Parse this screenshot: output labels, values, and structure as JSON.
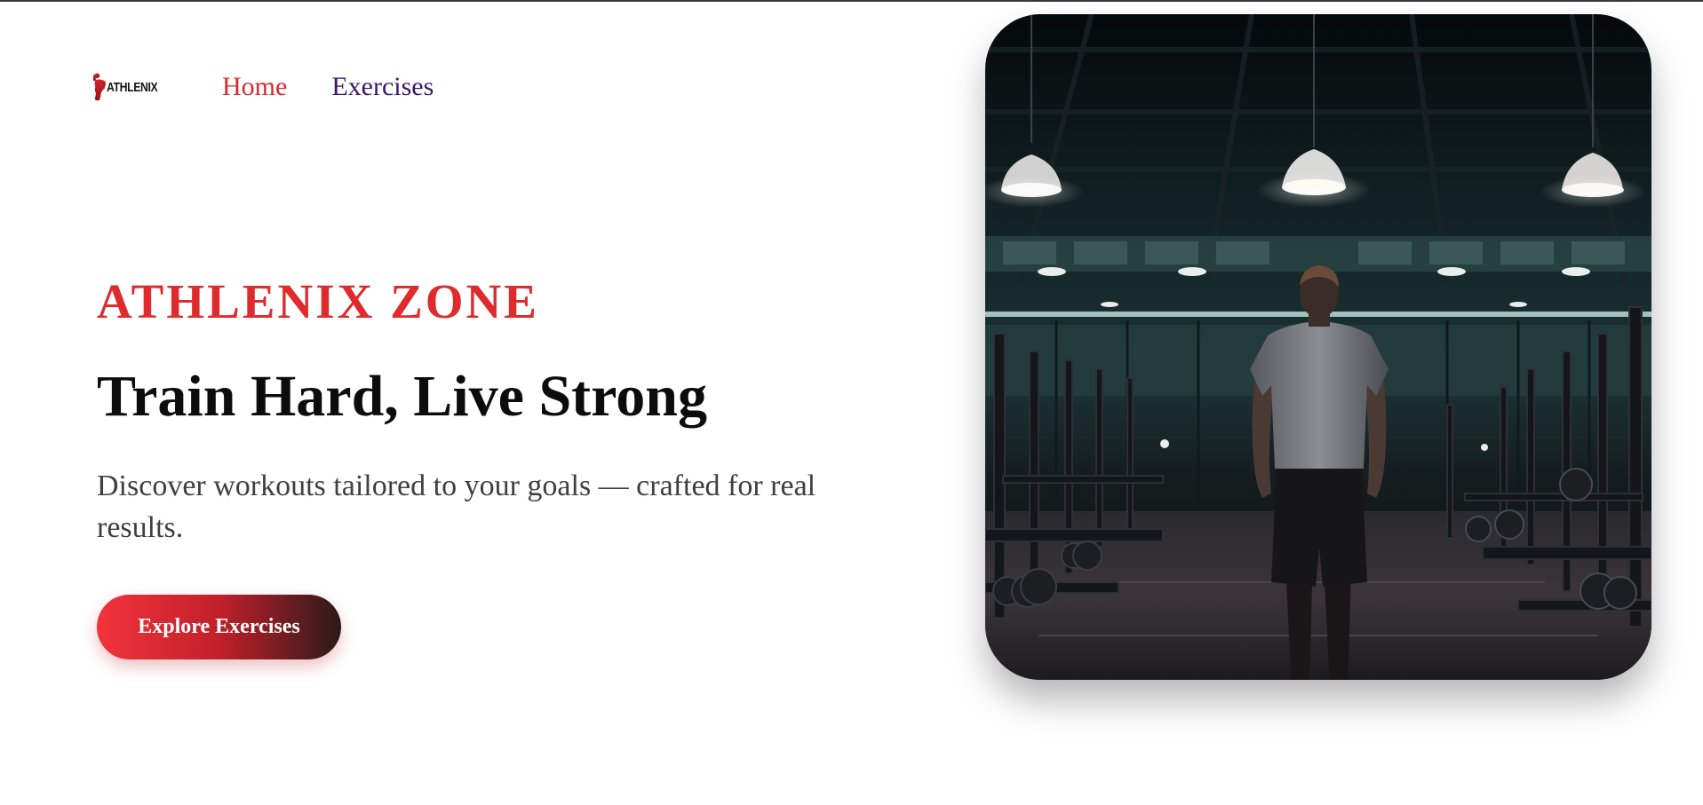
{
  "brand": {
    "logo_text": "ATHLENIX",
    "logo_icon": "athlete-flex-icon",
    "accent_color": "#df2a2e"
  },
  "nav": {
    "items": [
      {
        "label": "Home",
        "active": true
      },
      {
        "label": "Exercises",
        "active": false
      }
    ]
  },
  "hero": {
    "eyebrow": "ATHLENIX ZONE",
    "headline": "Train Hard, Live Strong",
    "subtext": "Discover workouts tailored to your goals — crafted for real results.",
    "cta_label": "Explore Exercises",
    "cta_gradient": [
      "#f2333c",
      "#c2202a",
      "#2b1a1a"
    ]
  },
  "hero_image": {
    "subject": "man-standing-in-dark-gym"
  }
}
